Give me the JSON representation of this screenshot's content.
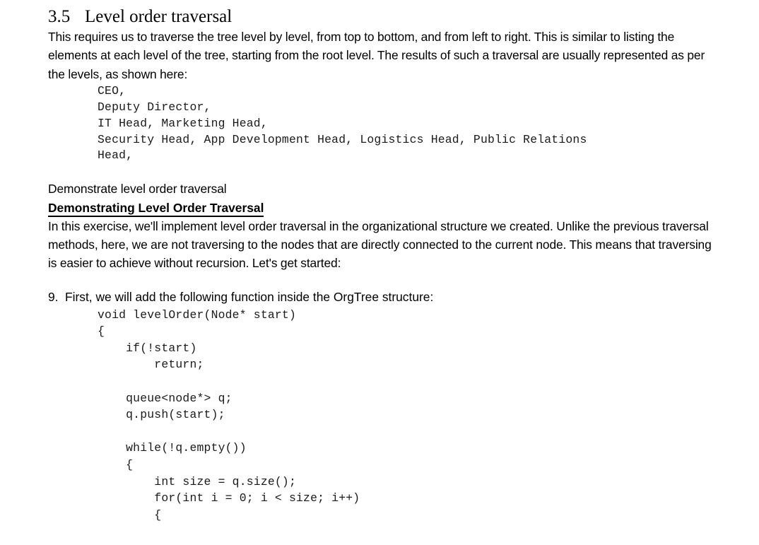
{
  "document": {
    "section": {
      "number": "3.5",
      "title": "Level order traversal"
    },
    "intro_paragraph": "This requires us to traverse the tree level by level, from top to bottom, and from left to right. This is similar to listing the elements at each level of the tree, starting from the root level. The results of such a traversal are usually represented as per the levels, as shown here:",
    "output_block": "CEO,\nDeputy Director,\nIT Head, Marketing Head,\nSecurity Head, App Development Head, Logistics Head, Public Relations\nHead,",
    "demonstrate_line": "Demonstrate level order traversal",
    "demonstrating_heading": "Demonstrating Level Order Traversal",
    "exercise_paragraph": "In this exercise, we'll implement level order traversal in the organizational structure we created. Unlike the previous traversal methods, here, we are not traversing to the nodes that are directly connected to the current node. This means that traversing is easier to achieve without recursion.  Let's get started:",
    "steps": [
      {
        "marker": "9.",
        "text": "First, we will add the following function inside the OrgTree structure:",
        "code": "void levelOrder(Node* start)\n{\n    if(!start)\n        return;\n\n    queue<node*> q;\n    q.push(start);\n\n    while(!q.empty())\n    {\n        int size = q.size();\n        for(int i = 0; i < size; i++)\n        {"
      }
    ]
  },
  "colors": {
    "page_background": "#ffffff",
    "body_text": "#000000",
    "code_text": "#1a1a1a"
  }
}
